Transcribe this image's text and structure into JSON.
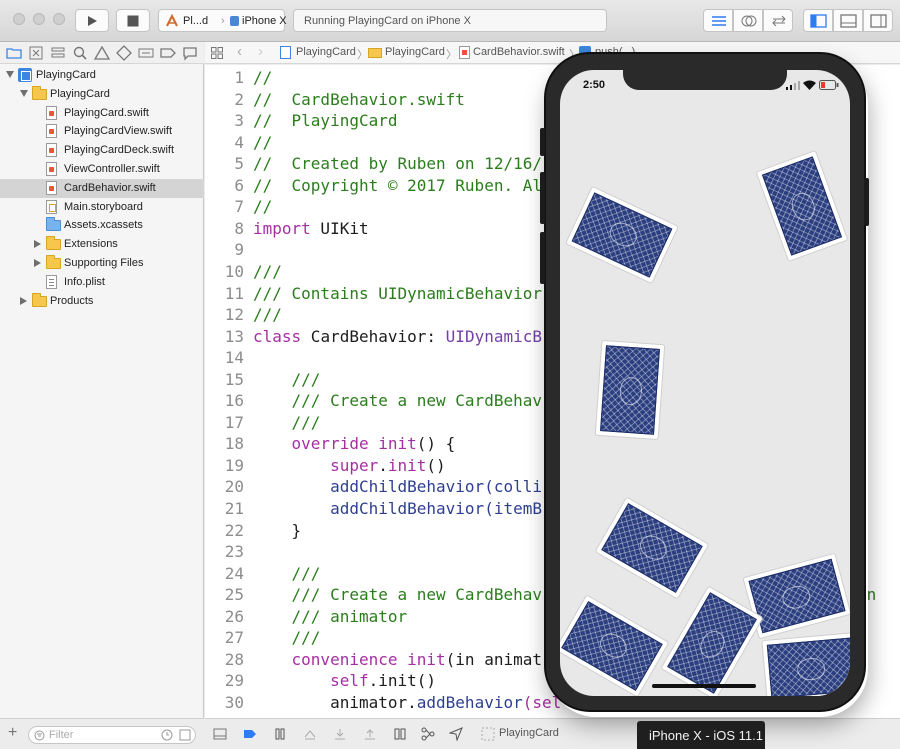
{
  "toolbar": {
    "scheme_target": "Pl...d",
    "scheme_device": "iPhone X",
    "activity_status": "Running PlayingCard on iPhone X"
  },
  "navigator": {
    "tree": [
      {
        "label": "PlayingCard",
        "kind": "project",
        "expanded": true
      },
      {
        "label": "PlayingCard",
        "kind": "folder",
        "expanded": true
      },
      {
        "label": "PlayingCard.swift",
        "kind": "swift"
      },
      {
        "label": "PlayingCardView.swift",
        "kind": "swift"
      },
      {
        "label": "PlayingCardDeck.swift",
        "kind": "swift"
      },
      {
        "label": "ViewController.swift",
        "kind": "swift"
      },
      {
        "label": "CardBehavior.swift",
        "kind": "swift",
        "selected": true
      },
      {
        "label": "Main.storyboard",
        "kind": "storyboard"
      },
      {
        "label": "Assets.xcassets",
        "kind": "assets"
      },
      {
        "label": "Extensions",
        "kind": "folder",
        "expanded": false
      },
      {
        "label": "Supporting Files",
        "kind": "folder",
        "expanded": false
      },
      {
        "label": "Info.plist",
        "kind": "plist"
      },
      {
        "label": "Products",
        "kind": "folder",
        "expanded": false
      }
    ],
    "filter_placeholder": "Filter"
  },
  "jumpbar": {
    "crumbs": [
      "PlayingCard",
      "PlayingCard",
      "CardBehavior.swift",
      "push(...)"
    ]
  },
  "editor": {
    "lines": [
      {
        "n": "1",
        "parts": [
          {
            "t": "//",
            "c": "comment"
          }
        ]
      },
      {
        "n": "2",
        "parts": [
          {
            "t": "//  CardBehavior.swift",
            "c": "comment"
          }
        ]
      },
      {
        "n": "3",
        "parts": [
          {
            "t": "//  PlayingCard",
            "c": "comment"
          }
        ]
      },
      {
        "n": "4",
        "parts": [
          {
            "t": "//",
            "c": "comment"
          }
        ]
      },
      {
        "n": "5",
        "parts": [
          {
            "t": "//  Created by Ruben on 12/16/",
            "c": "comment"
          }
        ]
      },
      {
        "n": "6",
        "parts": [
          {
            "t": "//  Copyright © 2017 Ruben. Al",
            "c": "comment"
          }
        ]
      },
      {
        "n": "7",
        "parts": [
          {
            "t": "//",
            "c": "comment"
          }
        ]
      },
      {
        "n": "8",
        "parts": [
          {
            "t": "import",
            "c": "kw"
          },
          {
            "t": " UIKit",
            "c": "plain"
          }
        ]
      },
      {
        "n": "9",
        "parts": []
      },
      {
        "n": "10",
        "parts": [
          {
            "t": "///",
            "c": "comment"
          }
        ]
      },
      {
        "n": "11",
        "parts": [
          {
            "t": "/// Contains UIDynamicBehavior",
            "c": "comment"
          }
        ]
      },
      {
        "n": "12",
        "parts": [
          {
            "t": "///",
            "c": "comment"
          }
        ]
      },
      {
        "n": "13",
        "parts": [
          {
            "t": "class",
            "c": "kw"
          },
          {
            "t": " CardBehavior: ",
            "c": "plain"
          },
          {
            "t": "UIDynamicB",
            "c": "type"
          }
        ]
      },
      {
        "n": "14",
        "parts": []
      },
      {
        "n": "15",
        "parts": [
          {
            "t": "    ///",
            "c": "comment"
          }
        ]
      },
      {
        "n": "16",
        "parts": [
          {
            "t": "    /// Create a new CardBehav",
            "c": "comment"
          }
        ]
      },
      {
        "n": "17",
        "parts": [
          {
            "t": "    ///",
            "c": "comment"
          }
        ]
      },
      {
        "n": "18",
        "parts": [
          {
            "t": "    override init",
            "c": "kw"
          },
          {
            "t": "() {",
            "c": "plain"
          }
        ]
      },
      {
        "n": "19",
        "parts": [
          {
            "t": "        super",
            "c": "kw"
          },
          {
            "t": ".",
            "c": "plain"
          },
          {
            "t": "init",
            "c": "kw"
          },
          {
            "t": "()",
            "c": "plain"
          }
        ]
      },
      {
        "n": "20",
        "parts": [
          {
            "t": "        addChildBehavior",
            "c": "call"
          },
          {
            "t": "(colli",
            "c": "call"
          }
        ]
      },
      {
        "n": "21",
        "parts": [
          {
            "t": "        addChildBehavior",
            "c": "call"
          },
          {
            "t": "(itemB",
            "c": "call"
          }
        ]
      },
      {
        "n": "22",
        "parts": [
          {
            "t": "    }",
            "c": "plain"
          }
        ]
      },
      {
        "n": "23",
        "parts": []
      },
      {
        "n": "24",
        "parts": [
          {
            "t": "    ///",
            "c": "comment"
          }
        ]
      },
      {
        "n": "25",
        "parts": [
          {
            "t": "    /// Create a new CardBehav",
            "c": "comment"
          }
        ]
      },
      {
        "n": "26",
        "parts": [
          {
            "t": "    /// animator",
            "c": "comment"
          }
        ]
      },
      {
        "n": "27",
        "parts": [
          {
            "t": "    ///",
            "c": "comment"
          }
        ]
      },
      {
        "n": "28",
        "parts": [
          {
            "t": "    convenience init",
            "c": "kw"
          },
          {
            "t": "(in animat",
            "c": "plain"
          }
        ]
      },
      {
        "n": "29",
        "parts": [
          {
            "t": "        self",
            "c": "kw"
          },
          {
            "t": ".init()",
            "c": "plain"
          }
        ]
      },
      {
        "n": "30",
        "parts": [
          {
            "t": "        animator.",
            "c": "plain"
          },
          {
            "t": "addBehavior",
            "c": "call"
          },
          {
            "t": "(sel",
            "c": "kw"
          }
        ]
      }
    ],
    "overflow_text": "en"
  },
  "simulator": {
    "clock": "2:50",
    "label": "iPhone X - iOS 11.1"
  },
  "debug_bar": {
    "target": "PlayingCard"
  }
}
